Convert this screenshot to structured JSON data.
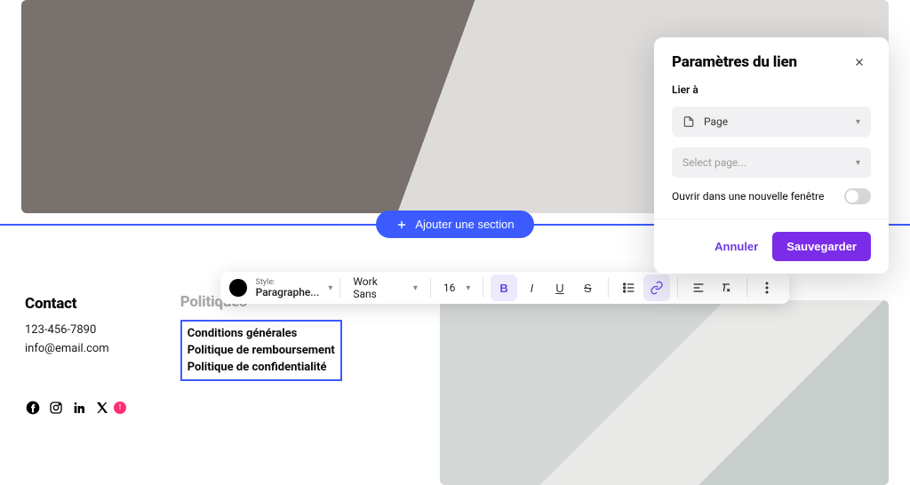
{
  "add_section": {
    "label": "Ajouter une section"
  },
  "footer": {
    "contact_heading": "Contact",
    "phone": "123-456-7890",
    "email": "info@email.com",
    "policies_heading": "Politiques",
    "policies": [
      "Conditions générales",
      "Politique de remboursement",
      "Politique de confidentialité"
    ]
  },
  "toolbar": {
    "style_label": "Style:",
    "style_value": "Paragraphe...",
    "font": "Work Sans",
    "size": "16"
  },
  "panel": {
    "title": "Paramètres du lien",
    "link_to_label": "Lier à",
    "link_type": "Page",
    "page_placeholder": "Select page...",
    "new_window_label": "Ouvrir dans une nouvelle fenêtre",
    "cancel": "Annuler",
    "save": "Sauvegarder"
  },
  "icons": {
    "plus": "plus-icon",
    "close": "close-icon",
    "chevron": "chevron-down-icon",
    "page": "page-icon"
  }
}
